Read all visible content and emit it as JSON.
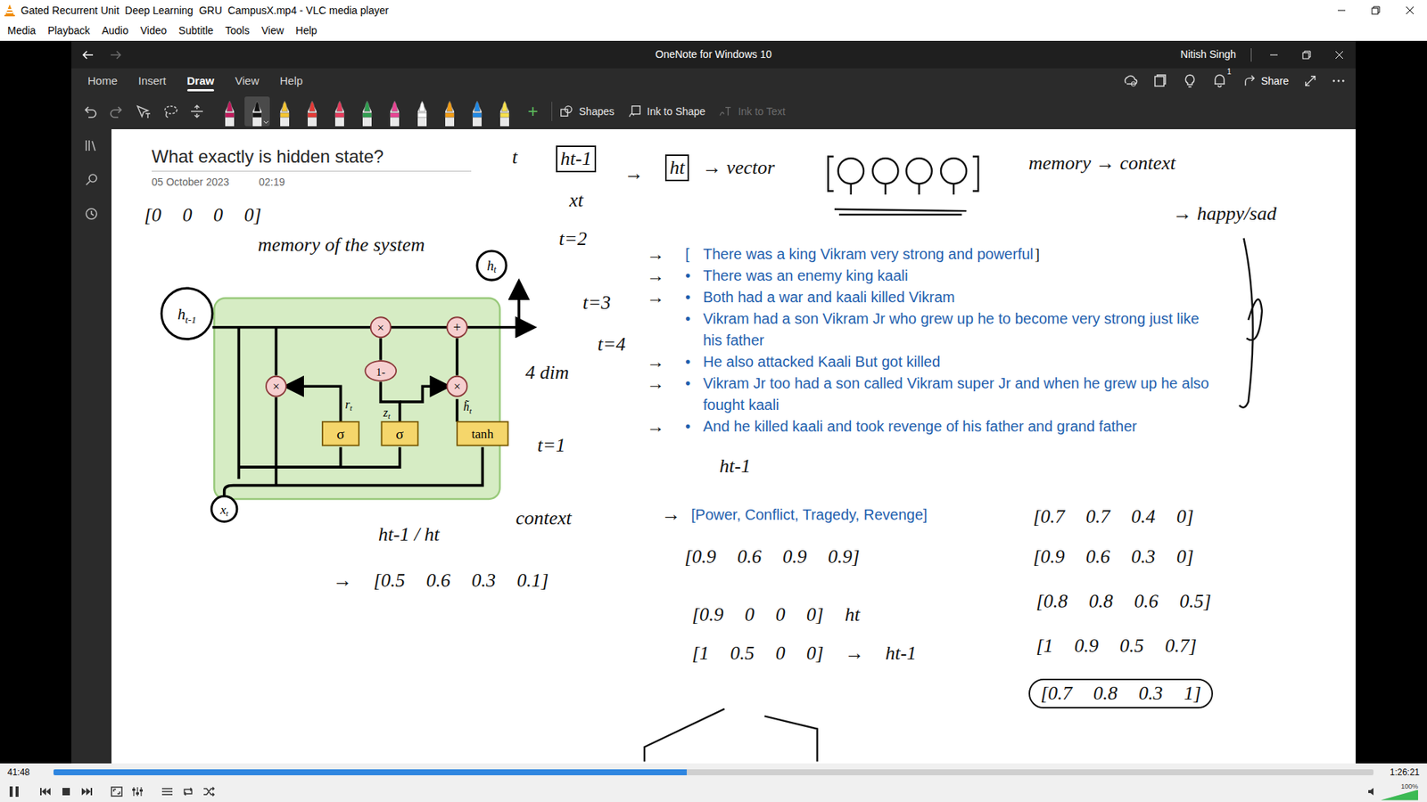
{
  "window": {
    "title": "Gated Recurrent Unit  Deep Learning  GRU  CampusX.mp4 - VLC media player"
  },
  "menu": [
    "Media",
    "Playback",
    "Audio",
    "Video",
    "Subtitle",
    "Tools",
    "View",
    "Help"
  ],
  "onenote": {
    "title": "OneNote for Windows 10",
    "user": "Nitish Singh",
    "notifications": "1",
    "share": "Share",
    "tabs": [
      {
        "label": "Home",
        "selected": false
      },
      {
        "label": "Insert",
        "selected": false
      },
      {
        "label": "Draw",
        "selected": true
      },
      {
        "label": "View",
        "selected": false
      },
      {
        "label": "Help",
        "selected": false
      }
    ],
    "pens": [
      {
        "color": "#c2185b",
        "selected": false
      },
      {
        "color": "#111111",
        "selected": true
      },
      {
        "color": "#f4c430",
        "selected": false
      },
      {
        "color": "#e53935",
        "selected": false
      },
      {
        "color": "#e8385a",
        "selected": false
      },
      {
        "color": "#2e9e4f",
        "selected": false
      },
      {
        "color": "#e84393",
        "selected": false
      },
      {
        "color": "#ffffff",
        "selected": false
      },
      {
        "color": "#f39c12",
        "selected": false
      },
      {
        "color": "#1e88e5",
        "selected": false
      },
      {
        "color": "#f7e04b",
        "selected": false
      }
    ],
    "add": "+",
    "tools": [
      {
        "label": "Shapes",
        "disabled": false
      },
      {
        "label": "Ink to Shape",
        "disabled": false
      },
      {
        "label": "Ink to Text",
        "disabled": true
      }
    ],
    "page": {
      "title": "What exactly is hidden state?",
      "date": "05 October 2023",
      "time": "02:19",
      "notes": [
        {
          "arrow": "→",
          "bullet": "[",
          "text": "There was a king Vikram very strong and powerful",
          "suffix": "]"
        },
        {
          "arrow": "→",
          "bullet": "•",
          "text": "There was an enemy king kaali",
          "suffix": ""
        },
        {
          "arrow": "→",
          "bullet": "•",
          "text": "Both had a war and kaali killed Vikram",
          "suffix": ""
        },
        {
          "arrow": "",
          "bullet": "•",
          "text": "Vikram had a son Vikram Jr who grew up he to become very strong just like his father",
          "suffix": ""
        },
        {
          "arrow": "→",
          "bullet": "•",
          "text": "He also attacked Kaali But got killed",
          "suffix": ""
        },
        {
          "arrow": "→",
          "bullet": "•",
          "text": "Vikram Jr too had a son called Vikram super Jr and when he grew up he also fought kaali",
          "suffix": ""
        },
        {
          "arrow": "→",
          "bullet": "•",
          "text": "And he killed kaali and took revenge of his father and grand father",
          "suffix": ""
        }
      ],
      "categories": {
        "arrow": "→",
        "text": "[Power, Conflict, Tragedy, Revenge]"
      },
      "ink": [
        {
          "text": "t",
          "kind": "plain"
        },
        {
          "text": "ht-1",
          "kind": "boxed"
        },
        {
          "text": "xt",
          "kind": "plain"
        },
        {
          "text": "→",
          "kind": "plain"
        },
        {
          "text": "ht",
          "kind": "boxed"
        },
        {
          "text": "→ vector",
          "kind": "plain"
        },
        {
          "text": "memory → context",
          "kind": "plain"
        },
        {
          "text": "[0 0 0 0]",
          "kind": "vector"
        },
        {
          "text": "memory of the system",
          "kind": "plain"
        },
        {
          "text": "t=2",
          "kind": "plain"
        },
        {
          "text": "t=3",
          "kind": "plain"
        },
        {
          "text": "t=4",
          "kind": "plain"
        },
        {
          "text": "4 dim",
          "kind": "plain"
        },
        {
          "text": "t=1",
          "kind": "plain"
        },
        {
          "text": "→ happy/sad",
          "kind": "plain"
        },
        {
          "text": "ht-1",
          "kind": "plain"
        },
        {
          "text": "ht-1 / ht",
          "kind": "plain"
        },
        {
          "text": "context",
          "kind": "plain"
        },
        {
          "text": "→ [0.5 0.6 0.3 0.1]",
          "kind": "vector"
        },
        {
          "text": "[0.9 0.6 0.9 0.9]",
          "kind": "vector"
        },
        {
          "text": "[0.9 0 0 0] ht",
          "kind": "vector"
        },
        {
          "text": "[1 0.5 0 0] → ht-1",
          "kind": "vector"
        },
        {
          "text": "[0.7 0.7 0.4 0]",
          "kind": "vector"
        },
        {
          "text": "[0.9 0.6 0.3 0]",
          "kind": "vector"
        },
        {
          "text": "[0.8 0.8 0.6 0.5]",
          "kind": "vector"
        },
        {
          "text": "[1 0.9 0.5 0.7]",
          "kind": "vector"
        },
        {
          "text": "[0.7 0.8 0.3 1]",
          "kind": "circled"
        }
      ],
      "diagram": {
        "h_prev": {
          "main": "h",
          "sub": "t-1"
        },
        "h_t": {
          "main": "h",
          "sub": "t"
        },
        "x_t": {
          "main": "x",
          "sub": "t"
        },
        "r_t": {
          "main": "r",
          "sub": "t"
        },
        "z_t": {
          "main": "z",
          "sub": "t"
        },
        "h_tilde": {
          "main": "h̃",
          "sub": "t"
        },
        "ops": [
          "×",
          "1-",
          "+",
          "×",
          "×"
        ],
        "gates": [
          "σ",
          "σ",
          "tanh"
        ]
      }
    }
  },
  "player": {
    "elapsed": "41:48",
    "total": "1:26:21",
    "level": 0.48,
    "playing": true,
    "volume": "100%",
    "volume_level": 1
  }
}
